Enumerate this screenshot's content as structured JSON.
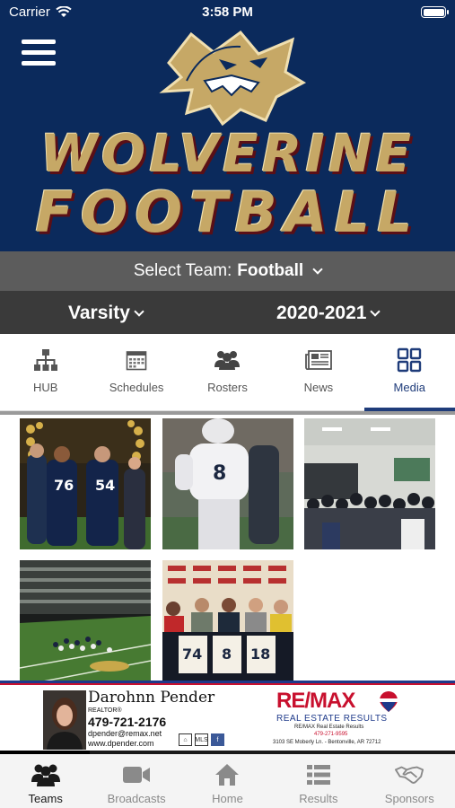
{
  "status_bar": {
    "carrier": "Carrier",
    "time": "3:58 PM"
  },
  "banner": {
    "title_line1": "WOLVERINE",
    "title_line2": "FOOTBALL"
  },
  "team_select": {
    "label": "Select Team:",
    "value": "Football"
  },
  "level_select": {
    "value": "Varsity"
  },
  "season_select": {
    "value": "2020-2021"
  },
  "tabs": [
    {
      "label": "HUB",
      "icon": "org-chart-icon"
    },
    {
      "label": "Schedules",
      "icon": "calendar-icon"
    },
    {
      "label": "Rosters",
      "icon": "users-icon"
    },
    {
      "label": "News",
      "icon": "newspaper-icon"
    },
    {
      "label": "Media",
      "icon": "grid-icon",
      "active": true
    }
  ],
  "media": {
    "photos": [
      {
        "jerseys": [
          "76",
          "54"
        ]
      },
      {
        "jerseys": [
          "8"
        ]
      },
      {
        "jerseys": []
      },
      {
        "jerseys": []
      },
      {
        "jerseys": [
          "74",
          "8",
          "18"
        ]
      }
    ]
  },
  "ad": {
    "agent_name": "Darohnn Pender",
    "agent_role": "REALTOR®",
    "agent_phone": "479-721-2176",
    "agent_email": "dpender@remax.net",
    "agent_web": "www.dpender.com",
    "brand": "RE/MAX",
    "brand_tagline": "REAL ESTATE RESULTS",
    "office_name": "RE/MAX Real Estate Results",
    "office_phone": "479-271-9595",
    "office_address": "3103 SE Moberly Ln. - Bentonville, AR 72712",
    "mls_label": "MLS"
  },
  "bottom_nav": [
    {
      "label": "Teams",
      "icon": "team-icon",
      "active": true
    },
    {
      "label": "Broadcasts",
      "icon": "video-camera-icon"
    },
    {
      "label": "Home",
      "icon": "home-icon"
    },
    {
      "label": "Results",
      "icon": "list-icon"
    },
    {
      "label": "Sponsors",
      "icon": "handshake-icon"
    }
  ],
  "colors": {
    "navy": "#0b2a5c",
    "gold": "#c6a866",
    "active_tab": "#1f3c7a",
    "remax_red": "#c8102e",
    "remax_blue": "#1e3a8a"
  }
}
